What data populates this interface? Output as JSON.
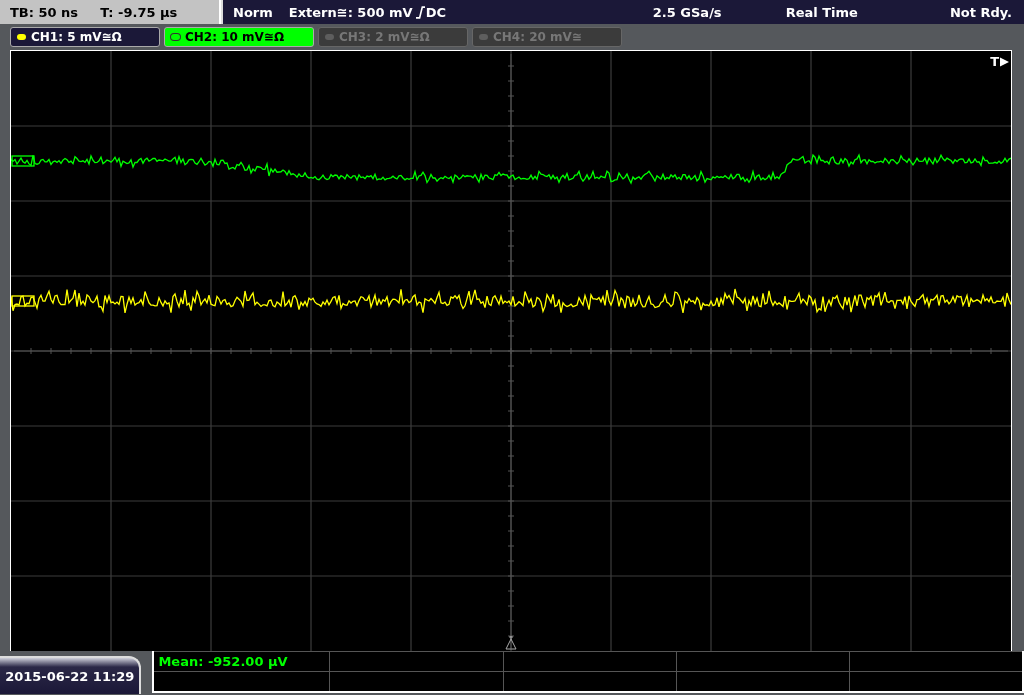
{
  "status_bar": {
    "timebase": "TB: 50 ns",
    "trigger_time": "T: -9.75 µs",
    "mode": "Norm",
    "trigger_source": "Extern≅: 500 mV",
    "trigger_coupling": "DC",
    "sample_rate": "2.5 GSa/s",
    "acquisition": "Real Time",
    "trigger_state": "Not Rdy."
  },
  "channels": [
    {
      "label": "CH1: 5 mV≅Ω",
      "selected": false,
      "on": true,
      "color": "#ffff00"
    },
    {
      "label": "CH2: 10 mV≅Ω",
      "selected": true,
      "on": true,
      "color": "#00ff00"
    },
    {
      "label": "CH3: 2 mV≅Ω",
      "selected": false,
      "on": false,
      "color": "#5e5e5e"
    },
    {
      "label": "CH4: 20 mV≅",
      "selected": false,
      "on": false,
      "color": "#5e5e5e"
    }
  ],
  "trigger_marker": "T",
  "date_time": "2015-06-22 11:29",
  "measurements": {
    "rows": [
      [
        "Mean: -952.00 µV",
        "",
        "",
        "",
        ""
      ],
      [
        "",
        "",
        "",
        "",
        ""
      ]
    ]
  }
}
